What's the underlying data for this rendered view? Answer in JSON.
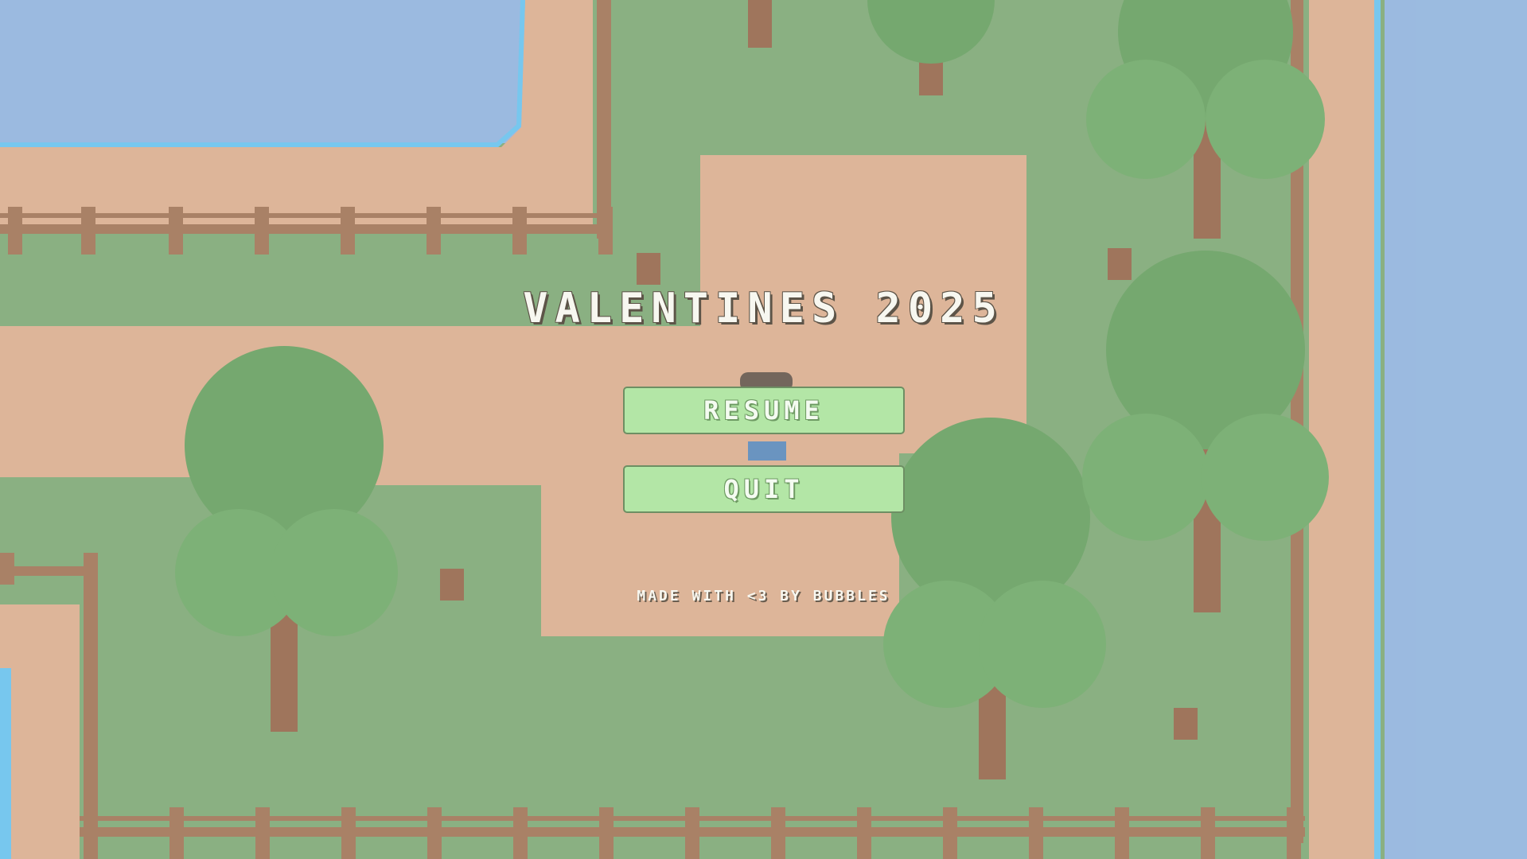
{
  "menu": {
    "title": "VALENTINES 2025",
    "buttons": {
      "resume": "RESUME",
      "quit": "QUIT"
    },
    "credit": "MADE WITH <3 BY BUBBLES"
  },
  "colors": {
    "water": "#8ab0de",
    "grass": "#76a46c",
    "dirt": "#dbaa88",
    "tree_canopy": "#5c9a55",
    "trunk": "#8f5c3d",
    "fence": "#9b6b4a",
    "button_fill": "#b3e6a6",
    "text": "#f7f7f0"
  },
  "icons": {
    "player": "player-character-sprite",
    "trees": "pine-tree-sprite",
    "stumps": "tree-stump-sprite"
  }
}
